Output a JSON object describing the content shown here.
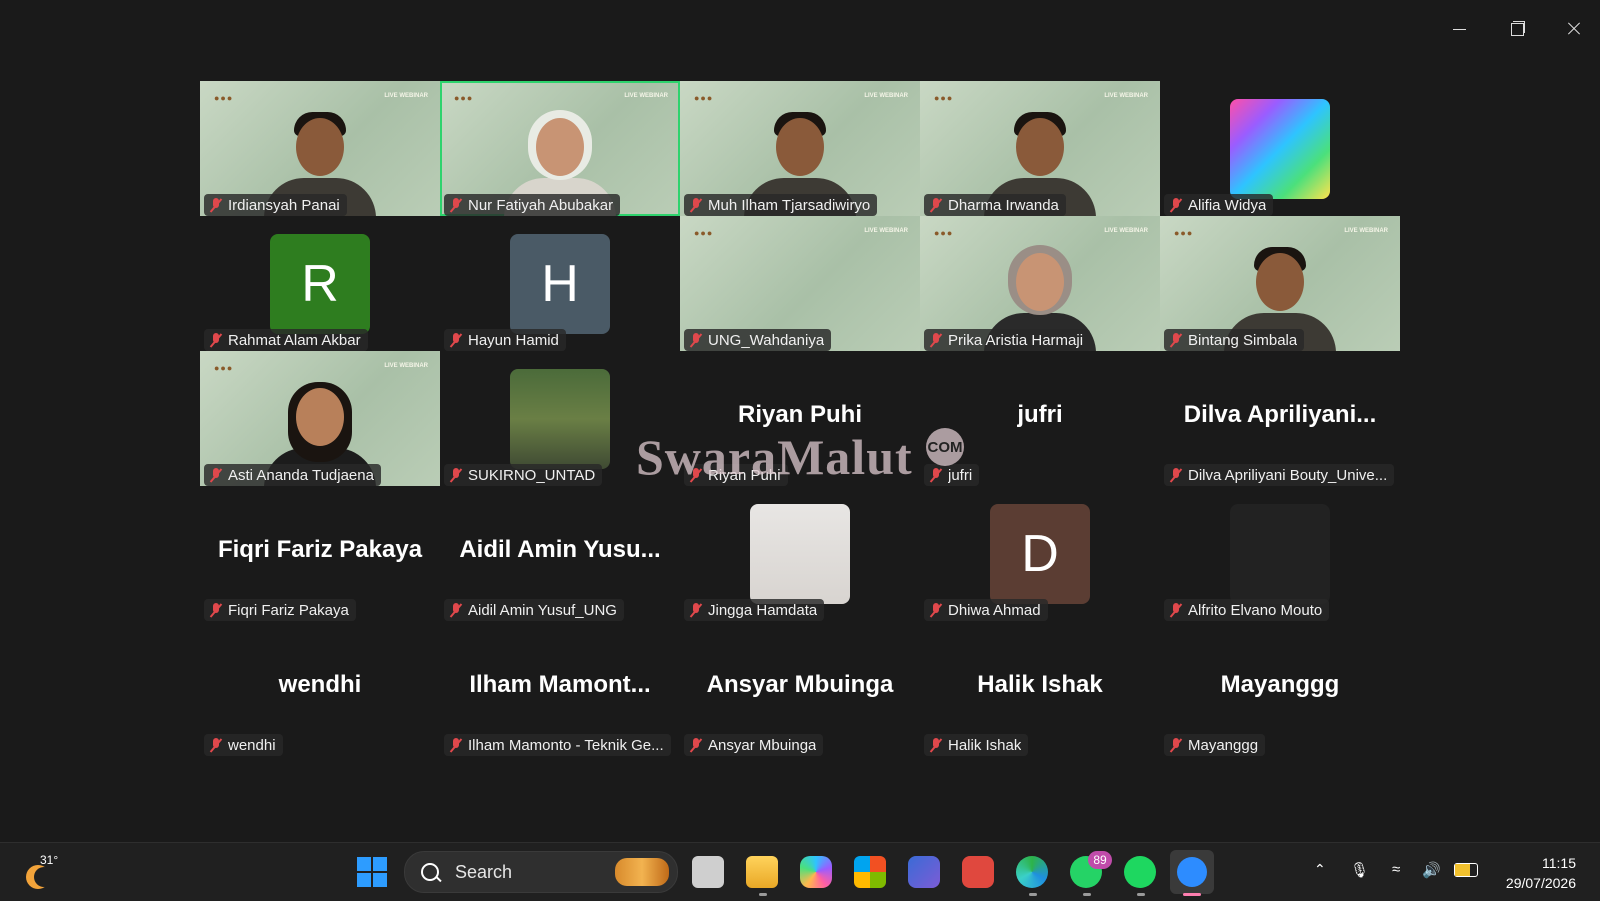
{
  "window": {
    "minimize_icon": "minimize-icon",
    "restore_icon": "restore-icon",
    "close_icon": "close-icon"
  },
  "participants": [
    {
      "name": "Irdiansyah Panai",
      "type": "video",
      "style": "short"
    },
    {
      "name": "Nur Fatiyah Abubakar",
      "type": "video",
      "style": "hijab",
      "active": true
    },
    {
      "name": "Muh Ilham Tjarsadiwiryo",
      "type": "video",
      "style": "short"
    },
    {
      "name": "Dharma Irwanda",
      "type": "video",
      "style": "short"
    },
    {
      "name": "Alifia Widya",
      "type": "avatar",
      "avatar_kind": "gradient"
    },
    {
      "name": "Rahmat Alam Akbar",
      "type": "avatar",
      "initial": "R",
      "color": "#2e7d1f"
    },
    {
      "name": "Hayun Hamid",
      "type": "avatar",
      "initial": "H",
      "color": "#4a5a66"
    },
    {
      "name": "UNG_Wahdaniya",
      "type": "video",
      "style": "empty"
    },
    {
      "name": "Prika Aristia Harmaji",
      "type": "video",
      "style": "hijab2"
    },
    {
      "name": "Bintang Simbala",
      "type": "video",
      "style": "short"
    },
    {
      "name": "Asti Ananda Tudjaena",
      "type": "video",
      "style": "lhair"
    },
    {
      "name": "SUKIRNO_UNTAD",
      "type": "avatar",
      "avatar_kind": "photo"
    },
    {
      "name": "Riyan Puhi",
      "type": "name",
      "display": "Riyan Puhi"
    },
    {
      "name": "jufri",
      "type": "name",
      "display": "jufri"
    },
    {
      "name": "Dilva Apriliyani Bouty_Unive...",
      "type": "name",
      "display": "Dilva  Apriliyani..."
    },
    {
      "name": "Fiqri Fariz Pakaya",
      "type": "name",
      "display": "Fiqri Fariz Pakaya"
    },
    {
      "name": "Aidil Amin Yusuf_UNG",
      "type": "name",
      "display": "Aidil  Amin  Yusu..."
    },
    {
      "name": "Jingga Hamdata",
      "type": "avatar",
      "avatar_kind": "photo2"
    },
    {
      "name": "Dhiwa Ahmad",
      "type": "avatar",
      "initial": "D",
      "color": "#5b3d33"
    },
    {
      "name": "Alfrito Elvano Mouto",
      "type": "avatar",
      "avatar_kind": "dark"
    },
    {
      "name": "wendhi",
      "type": "name",
      "display": "wendhi"
    },
    {
      "name": "Ilham Mamonto - Teknik Ge...",
      "type": "name",
      "display": "Ilham  Mamont..."
    },
    {
      "name": "Ansyar Mbuinga",
      "type": "name",
      "display": "Ansyar Mbuinga"
    },
    {
      "name": "Halik Ishak",
      "type": "name",
      "display": "Halik Ishak"
    },
    {
      "name": "Mayanggg",
      "type": "name",
      "display": "Mayanggg"
    }
  ],
  "video_badge": "LIVE WEBINAR",
  "watermark": {
    "text": "SwaraMalut",
    "suffix": "COM"
  },
  "taskbar": {
    "weather_temp": "31°",
    "search_placeholder": "Search",
    "whatsapp_badge": "89",
    "time": "11:15",
    "date": "29/07/2026",
    "icons": [
      "task-view-icon",
      "file-explorer-icon",
      "copilot-icon",
      "microsoft-store-icon",
      "app-icon",
      "presentation-icon",
      "edge-icon",
      "whatsapp-icon",
      "spotify-icon",
      "zoom-icon"
    ]
  }
}
